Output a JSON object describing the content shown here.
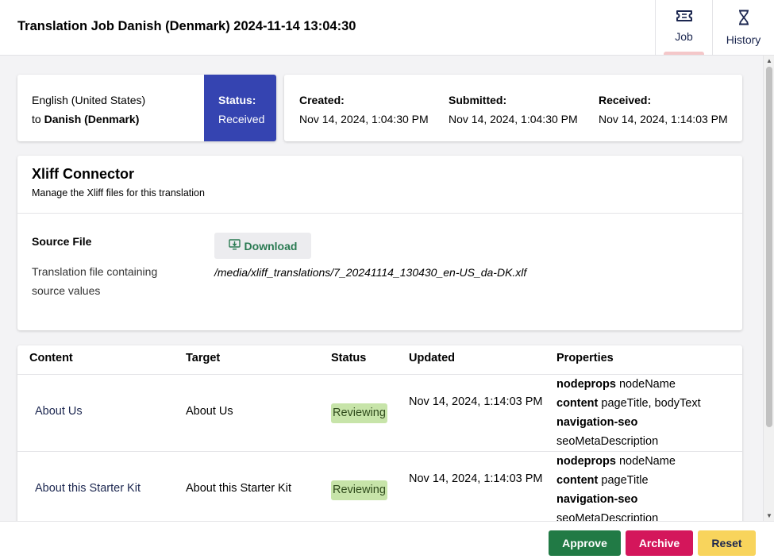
{
  "header": {
    "title": "Translation Job Danish (Denmark) 2024-11-14 13:04:30",
    "tabs": [
      {
        "label": "Job",
        "icon": "ticket-icon",
        "active": true
      },
      {
        "label": "History",
        "icon": "hourglass-icon",
        "active": false
      }
    ]
  },
  "summary": {
    "source_language": "English (United States)",
    "to_word": "to",
    "target_language": "Danish (Denmark)",
    "status_label": "Status:",
    "status_value": "Received",
    "created_label": "Created:",
    "created_value": "Nov 14, 2024, 1:04:30 PM",
    "submitted_label": "Submitted:",
    "submitted_value": "Nov 14, 2024, 1:04:30 PM",
    "received_label": "Received:",
    "received_value": "Nov 14, 2024, 1:14:03 PM"
  },
  "xliff": {
    "title": "Xliff Connector",
    "subtitle": "Manage the Xliff files for this translation",
    "source_label": "Source File",
    "source_desc": "Translation file containing source values",
    "download_label": "Download",
    "path": "/media/xliff_translations/7_20241114_130430_en-US_da-DK.xlf"
  },
  "table": {
    "headers": [
      "Content",
      "Target",
      "Status",
      "Updated",
      "Properties"
    ],
    "rows": [
      {
        "content": "About Us",
        "target": "About Us",
        "status": "Reviewing",
        "updated": "Nov 14, 2024, 1:14:03 PM",
        "props": [
          {
            "key": "nodeprops",
            "value": "nodeName"
          },
          {
            "key": "content",
            "value": "pageTitle, bodyText"
          },
          {
            "key": "navigation-seo",
            "value": ""
          },
          {
            "key": "",
            "value": "seoMetaDescription"
          }
        ]
      },
      {
        "content": "About this Starter Kit",
        "target": "About this Starter Kit",
        "status": "Reviewing",
        "updated": "Nov 14, 2024, 1:14:03 PM",
        "props": [
          {
            "key": "nodeprops",
            "value": "nodeName"
          },
          {
            "key": "content",
            "value": "pageTitle"
          },
          {
            "key": "navigation-seo",
            "value": ""
          },
          {
            "key": "",
            "value": "seoMetaDescription"
          }
        ]
      }
    ]
  },
  "footer": {
    "approve_label": "Approve",
    "archive_label": "Archive",
    "reset_label": "Reset"
  },
  "colors": {
    "status_block": "#3544b1",
    "approve": "#217a45",
    "archive": "#d4165b",
    "reset": "#f8d45c",
    "badge": "#c7e4a9",
    "download_text": "#2a7a52"
  }
}
